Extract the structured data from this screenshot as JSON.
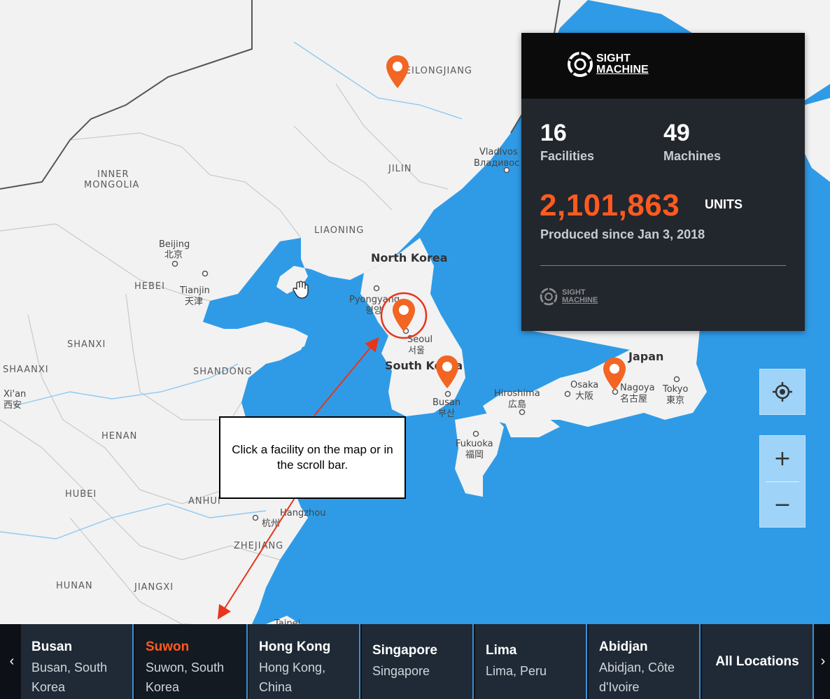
{
  "map": {
    "region_labels": [
      "HEILONGJIANG",
      "INNER",
      "MONGOLIA",
      "JILIN",
      "LIAONING",
      "HEBEI",
      "SHANXI",
      "SHAANXI",
      "SHANDONG",
      "HENAN",
      "HUBEI",
      "ANHUI",
      "ZHEJIANG",
      "HUNAN",
      "JIANGXI"
    ],
    "country_labels": [
      "North Korea",
      "South Korea",
      "Japan"
    ],
    "city_labels": {
      "vladivostok": "Vladivos",
      "vladivostok_ru": "Владивос",
      "beijing": "Beijing",
      "beijing_zh": "北京",
      "tianjin": "Tianjin",
      "tianjin_zh": "天津",
      "pyongyang": "Pyongyang",
      "pyongyang_ko": "평양",
      "seoul": "Seoul",
      "seoul_ko": "서울",
      "busan": "Busan",
      "busan_ko": "부산",
      "xian": "Xi'an",
      "xian_zh": "西安",
      "hiroshima": "Hiroshima",
      "hiroshima_ja": "広島",
      "osaka": "Osaka",
      "osaka_ja": "大阪",
      "nagoya": "Nagoya",
      "nagoya_ja": "名古屋",
      "tokyo": "Tokyo",
      "tokyo_ja": "東京",
      "fukuoka": "Fukuoka",
      "fukuoka_ja": "福岡",
      "hangzhou": "Hangzhou",
      "hangzhou_zh": "杭州",
      "taipei": "Taipei"
    },
    "pins": [
      "heilongjiang-pin",
      "suwon-pin",
      "busan-pin",
      "nagoya-pin"
    ],
    "pin_color": "#f26522",
    "water_color": "#2f9be6",
    "land_color": "#f2f2f2"
  },
  "panel": {
    "logo_line1": "SIGHT",
    "logo_line2": "MACHINE",
    "facilities_value": "16",
    "facilities_label": "Facilities",
    "machines_value": "49",
    "machines_label": "Machines",
    "units_value": "2,101,863",
    "units_label": "UNITS",
    "since": "Produced since Jan 3, 2018",
    "footer_logo_line1": "SIGHT",
    "footer_logo_line2": "MACHINE",
    "accent": "#ff5a1f"
  },
  "controls": {
    "locate_icon": "crosshair-icon",
    "zoom_in": "+",
    "zoom_out": "−"
  },
  "callout": {
    "text": "Click a facility on the map or in the scroll bar."
  },
  "scrollbar": {
    "prev": "‹",
    "next": "›",
    "cards": [
      {
        "title": "Busan",
        "subtitle": "Busan, South Korea"
      },
      {
        "title": "Suwon",
        "subtitle": "Suwon, South Korea"
      },
      {
        "title": "Hong Kong",
        "subtitle": "Hong Kong, China"
      },
      {
        "title": "Singapore",
        "subtitle": "Singapore"
      },
      {
        "title": "Lima",
        "subtitle": "Lima, Peru"
      },
      {
        "title": "Abidjan",
        "subtitle": "Abidjan, Côte d'Ivoire"
      }
    ],
    "all_locations": "All Locations"
  },
  "annotation_color": "#e8351c"
}
